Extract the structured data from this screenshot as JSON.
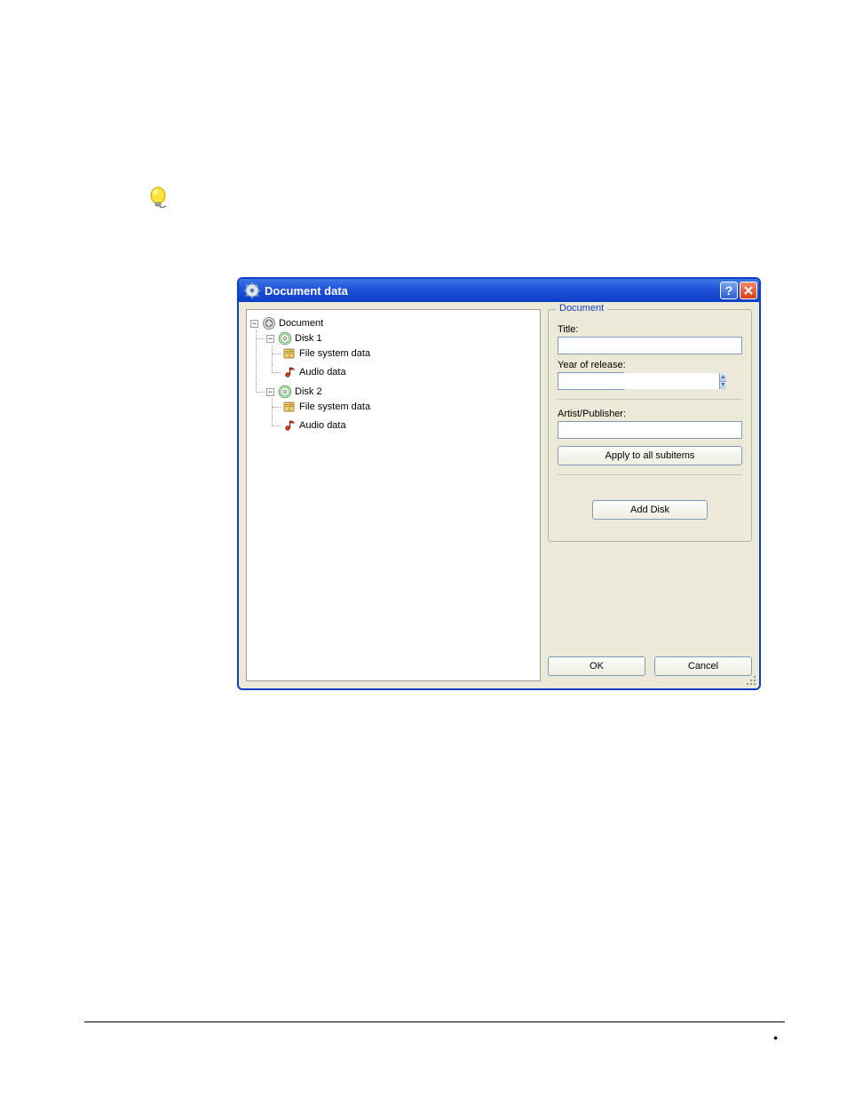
{
  "dialog": {
    "title": "Document data",
    "groupbox_legend": "Document",
    "fields": {
      "title_label": "Title:",
      "title_value": "",
      "year_label": "Year of release:",
      "year_value": "",
      "artist_label": "Artist/Publisher:",
      "artist_value": ""
    },
    "buttons": {
      "apply_subitems": "Apply to all subitems",
      "add_disk": "Add Disk",
      "ok": "OK",
      "cancel": "Cancel"
    }
  },
  "tree": {
    "root": "Document",
    "disks": [
      {
        "label": "Disk 1",
        "children": [
          {
            "label": "File system data",
            "icon": "book"
          },
          {
            "label": "Audio data",
            "icon": "audio"
          }
        ]
      },
      {
        "label": "Disk 2",
        "children": [
          {
            "label": "File system data",
            "icon": "book"
          },
          {
            "label": "Audio data",
            "icon": "audio"
          }
        ]
      }
    ]
  },
  "icons": {
    "expander_minus": "−"
  }
}
